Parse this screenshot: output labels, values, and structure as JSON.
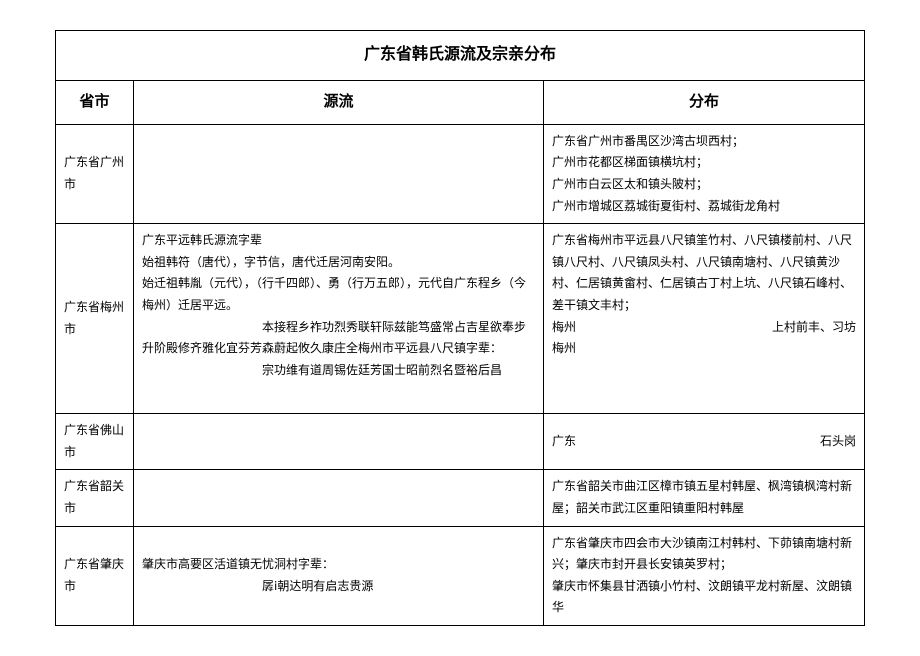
{
  "title": "广东省韩氏源流及宗亲分布",
  "headers": {
    "province": "省市",
    "source": "源流",
    "distribution": "分布"
  },
  "rows": [
    {
      "province": "广东省广州市",
      "source": "",
      "distribution": "广东省广州市番禺区沙湾古坝西村；\n广州市花都区梯面镇横坑村；\n广州市白云区太和镇头陂村；\n广州市增城区荔城街夏街村、荔城街龙角村"
    },
    {
      "province": "广东省梅州市",
      "source_lines": [
        "广东平远韩氏源流字辈",
        "始祖韩符（唐代），字节信，唐代迁居河南安阳。",
        "始迁祖韩胤（元代），（行千四郎）、勇（行万五郎），元代自广东程乡（今梅州）迁居平远。",
        "本接程乡祚功烈秀联轩际兹能笃盛常占吉星欲奉步升阶殿修齐雅化宜芬芳森蔚起攸久康庄全梅州市平远县八尺镇字辈：",
        "宗功维有道周锡佐廷芳国士昭前烈名暨裕后昌"
      ],
      "distribution_lines": [
        "广东省梅州市平远县八尺镇筀竹村、八尺镇楼前村、八尺镇八尺村、八尺镇凤头村、八尺镇南塘村、八尺镇黄沙村、仁居镇黄畲村、仁居镇古丁村上坑、八尺镇石峰村、差干镇文丰村；",
        {
          "left": "梅州",
          "right": "上村前丰、习坊"
        },
        "梅州"
      ],
      "tall": true
    },
    {
      "province": "广东省佛山市",
      "source": "",
      "distribution_spread": {
        "left": "广东",
        "right": "石头岗"
      }
    },
    {
      "province": "广东省韶关市",
      "source": "",
      "distribution": "广东省韶关市曲江区樟市镇五星村韩屋、枫湾镇枫湾村新屋；韶关市武江区重阳镇重阳村韩屋"
    },
    {
      "province": "广东省肇庆市",
      "source_lines": [
        "肇庆市高要区活道镇无忧洞村字辈：",
        "孱ⅰ朝达明有启志贵源"
      ],
      "distribution": "广东省肇庆市四会市大沙镇南江村韩村、下茆镇南塘村新兴；肇庆市封开县长安镇英罗村；\n肇庆市怀集县甘洒镇小竹村、汶朗镇平龙村新屋、汶朗镇华"
    }
  ]
}
